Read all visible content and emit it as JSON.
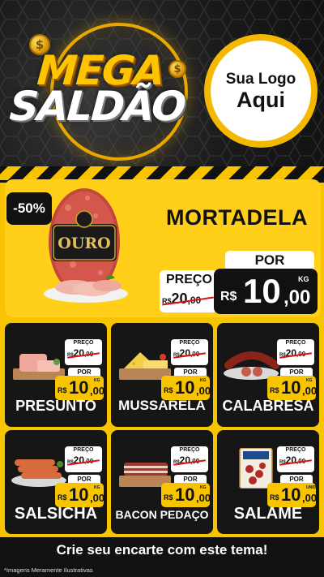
{
  "header": {
    "title_line1": "MEGA",
    "title_line2": "SALDÃO",
    "coin_symbol": "$",
    "logo_line1": "Sua Logo",
    "logo_line2": "Aqui"
  },
  "featured": {
    "badge": "-50%",
    "name": "MORTADELA",
    "brand_label": "OURO",
    "preco_label": "PREÇO",
    "old_currency": "R$",
    "old_int": "20",
    "old_cents": ",00",
    "por_label": "POR",
    "new_currency": "R$",
    "new_int": "10",
    "new_cents": ",00",
    "unit": "KG"
  },
  "products": [
    {
      "name": "PRESUNTO",
      "preco_label": "PREÇO",
      "old_currency": "R$",
      "old_int": "20",
      "old_cents": ",00",
      "por_label": "POR",
      "new_currency": "R$",
      "new_int": "10",
      "new_cents": ",00",
      "unit": "KG"
    },
    {
      "name": "MUSSARELA",
      "preco_label": "PREÇO",
      "old_currency": "R$",
      "old_int": "20",
      "old_cents": ",00",
      "por_label": "POR",
      "new_currency": "R$",
      "new_int": "10",
      "new_cents": ",00",
      "unit": "KG"
    },
    {
      "name": "CALABRESA",
      "preco_label": "PREÇO",
      "old_currency": "R$",
      "old_int": "20",
      "old_cents": ",00",
      "por_label": "POR",
      "new_currency": "R$",
      "new_int": "10",
      "new_cents": ",00",
      "unit": "KG"
    },
    {
      "name": "SALSICHA",
      "preco_label": "PREÇO",
      "old_currency": "R$",
      "old_int": "20",
      "old_cents": ",00",
      "por_label": "POR",
      "new_currency": "R$",
      "new_int": "10",
      "new_cents": ",00",
      "unit": "KG"
    },
    {
      "name": "BACON PEDAÇO",
      "preco_label": "PREÇO",
      "old_currency": "R$",
      "old_int": "20",
      "old_cents": ",00",
      "por_label": "POR",
      "new_currency": "R$",
      "new_int": "10",
      "new_cents": ",00",
      "unit": "KG"
    },
    {
      "name": "SALAME",
      "preco_label": "PREÇO",
      "old_currency": "R$",
      "old_int": "20",
      "old_cents": ",00",
      "por_label": "POR",
      "new_currency": "R$",
      "new_int": "10",
      "new_cents": ",00",
      "unit": "UNID"
    }
  ],
  "footer": {
    "cta": "Crie seu encarte com este tema!",
    "disclaimer": "*Imagens Meramente Ilustrativas"
  },
  "colors": {
    "accent_yellow": "#f8c400",
    "dark": "#161616",
    "strike_red": "#dd1111"
  }
}
